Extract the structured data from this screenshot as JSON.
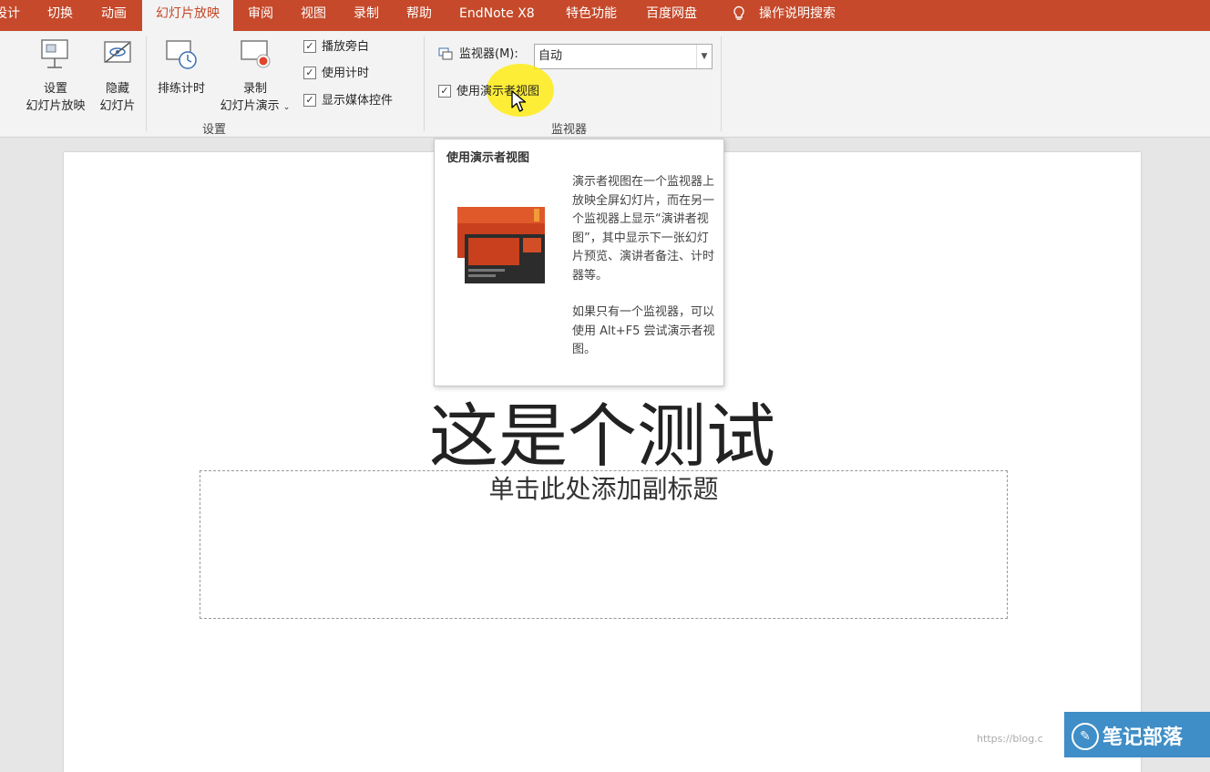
{
  "tabs": [
    {
      "label": "设计",
      "active": false
    },
    {
      "label": "切换",
      "active": false
    },
    {
      "label": "动画",
      "active": false
    },
    {
      "label": "幻灯片放映",
      "active": true
    },
    {
      "label": "审阅",
      "active": false
    },
    {
      "label": "视图",
      "active": false
    },
    {
      "label": "录制",
      "active": false
    },
    {
      "label": "帮助",
      "active": false
    },
    {
      "label": "EndNote X8",
      "active": false
    },
    {
      "label": "特色功能",
      "active": false
    },
    {
      "label": "百度网盘",
      "active": false
    }
  ],
  "search_label": "操作说明搜索",
  "ribbon": {
    "setup_show": {
      "line1": "设置",
      "line2": "幻灯片放映"
    },
    "hide_slide": {
      "line1": "隐藏",
      "line2": "幻灯片"
    },
    "rehearse": {
      "label": "排练计时"
    },
    "record": {
      "line1": "录制",
      "line2": "幻灯片演示"
    },
    "checks": [
      {
        "label": "播放旁白",
        "checked": true
      },
      {
        "label": "使用计时",
        "checked": true
      },
      {
        "label": "显示媒体控件",
        "checked": true
      }
    ],
    "group_setup_label": "设置",
    "monitor_label": "监视器(M):",
    "monitor_value": "自动",
    "presenter_view": {
      "label": "使用演示者视图",
      "checked": true
    },
    "group_monitors_label": "监视器"
  },
  "tooltip": {
    "title": "使用演示者视图",
    "para1": "演示者视图在一个监视器上放映全屏幻灯片，而在另一个监视器上显示“演讲者视图”，其中显示下一张幻灯片预览、演讲者备注、计时器等。",
    "para2": "如果只有一个监视器，可以使用 Alt+F5 尝试演示者视图。"
  },
  "slide": {
    "title": "这是个测试",
    "subtitle_placeholder": "单击此处添加副标题"
  },
  "watermark": "笔记部落",
  "url_watermark": "https://blog.c",
  "colors": {
    "accent": "#c5492a",
    "highlight": "#ffeb00"
  }
}
